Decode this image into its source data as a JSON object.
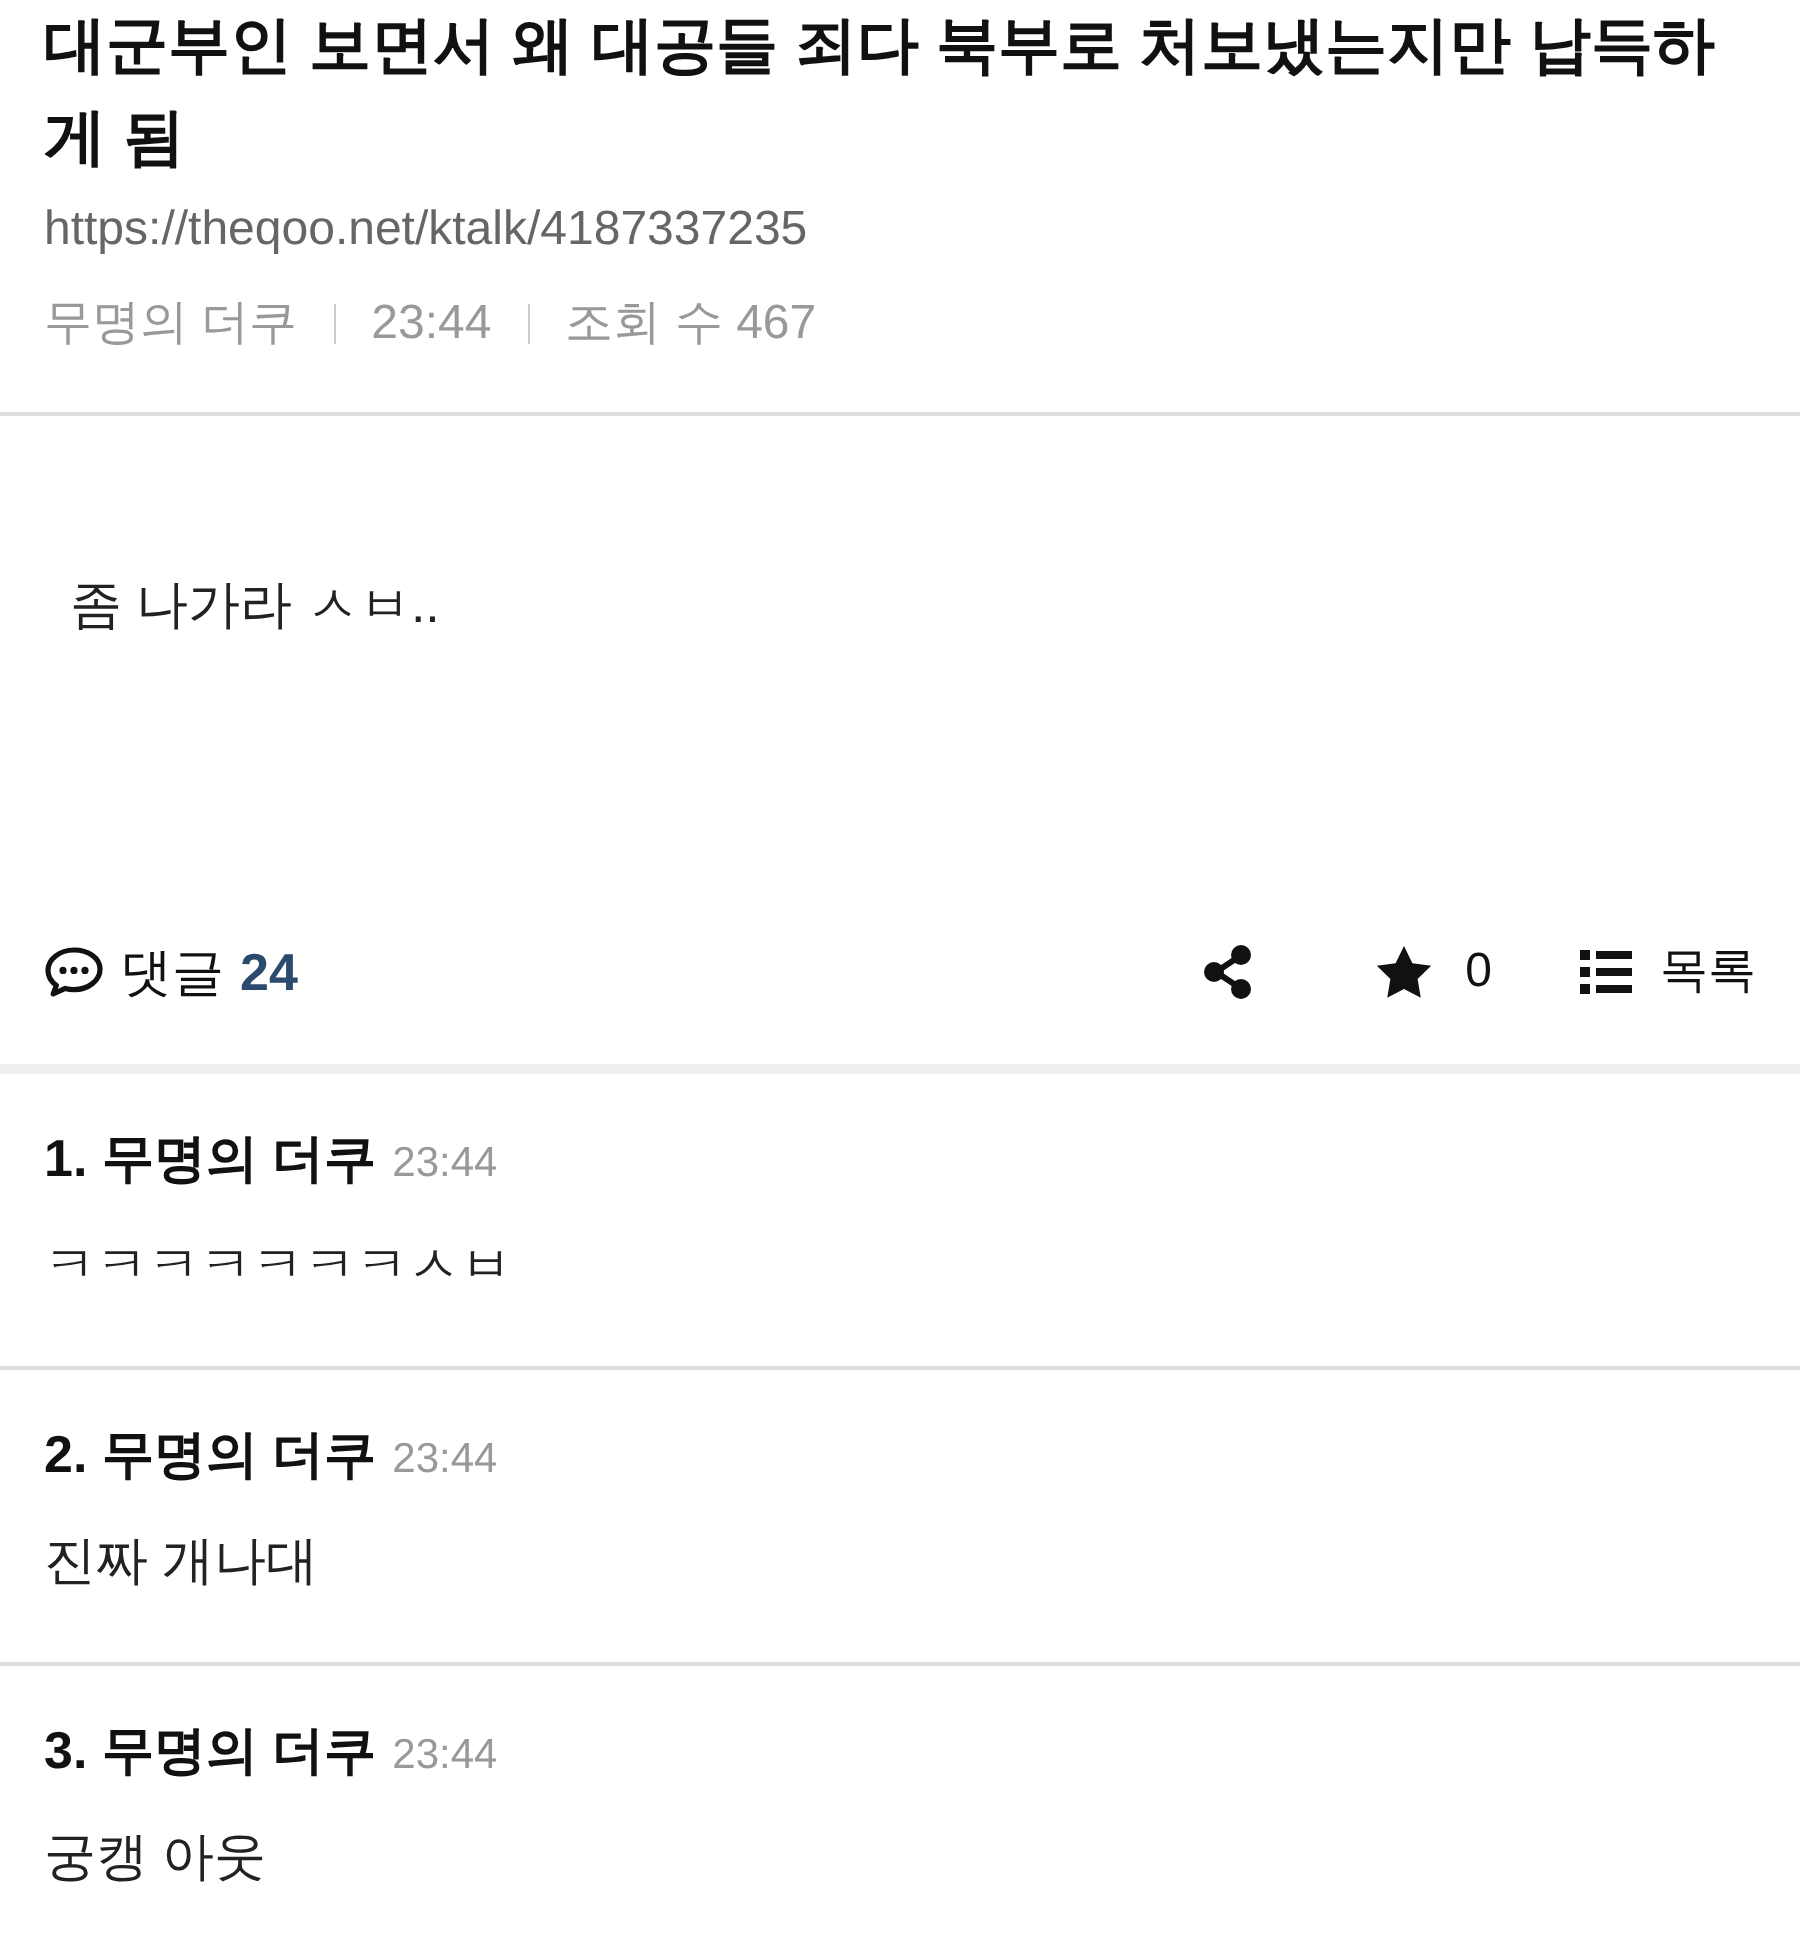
{
  "post": {
    "title": "대군부인 보면서 왜 대공들 죄다 북부로 처보냈는지만 납득하게 됨",
    "url": "https://theqoo.net/ktalk/4187337235",
    "author": "무명의 더쿠",
    "time": "23:44",
    "views": "조회 수 467",
    "body": "좀 나가라 ㅅㅂ.."
  },
  "actions": {
    "comments_label": "댓글",
    "comments_count": "24",
    "star_count": "0",
    "list_label": "목록"
  },
  "comments": [
    {
      "header": "1. 무명의 더쿠",
      "time": "23:44",
      "text": "ㅋㅋㅋㅋㅋㅋㅋㅅㅂ"
    },
    {
      "header": "2. 무명의 더쿠",
      "time": "23:44",
      "text": "진짜 개나대"
    },
    {
      "header": "3. 무명의 더쿠",
      "time": "23:44",
      "text": "궁캥 아웃"
    }
  ]
}
